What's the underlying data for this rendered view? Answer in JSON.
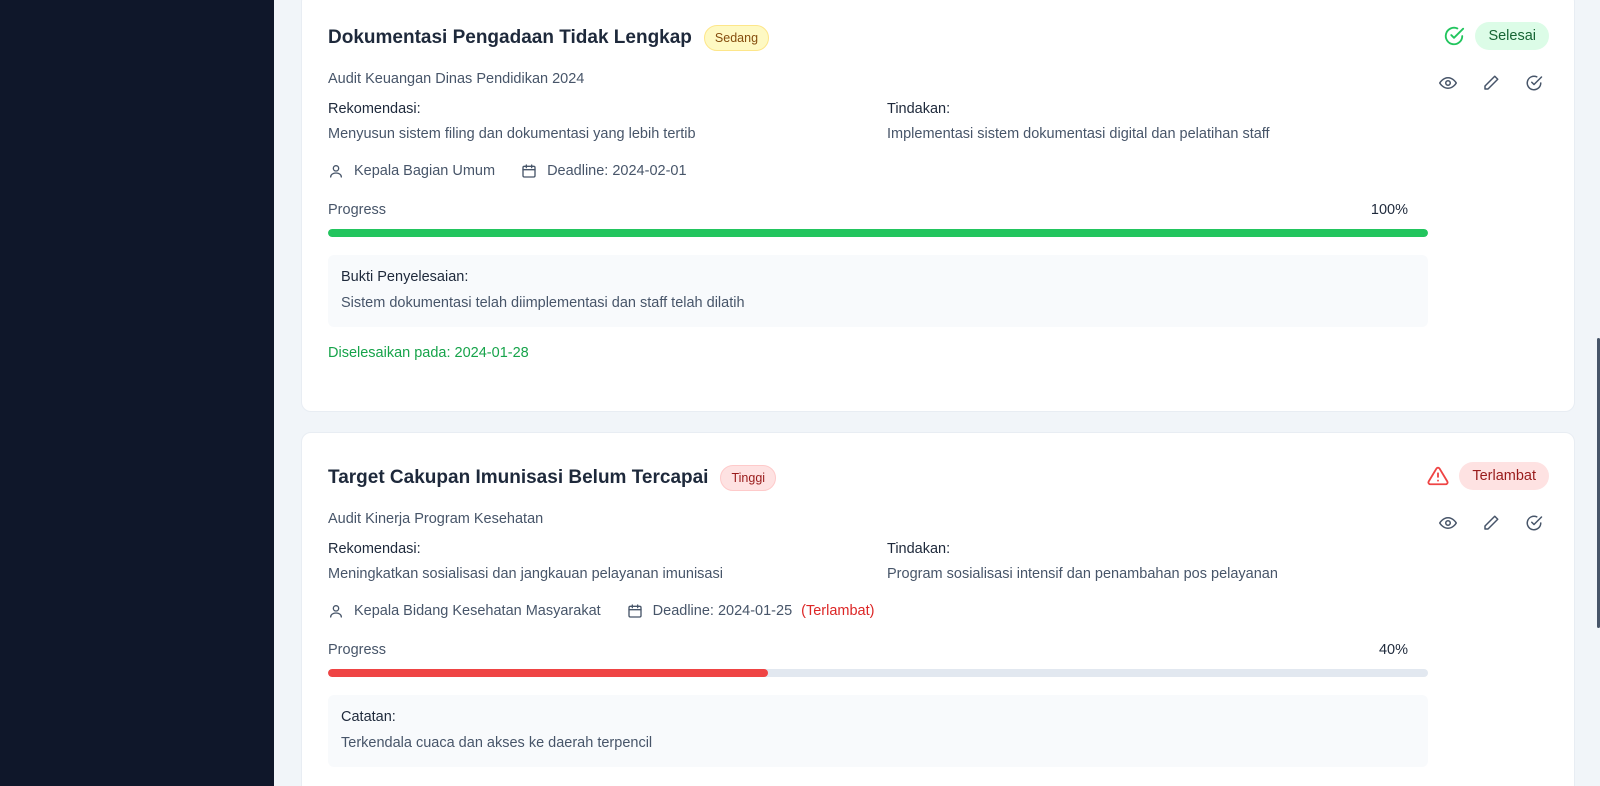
{
  "findings": [
    {
      "title": "Dokumentasi Pengadaan Tidak Lengkap",
      "priority": "Sedang",
      "audit": "Audit Keuangan Dinas Pendidikan 2024",
      "recommendation_label": "Rekomendasi:",
      "recommendation": "Menyusun sistem filing dan dokumentasi yang lebih tertib",
      "action_label": "Tindakan:",
      "action": "Implementasi sistem dokumentasi digital dan pelatihan staff",
      "pic": "Kepala Bagian Umum",
      "deadline": "Deadline: 2024-02-01",
      "progress_label": "Progress",
      "progress_text": "100%",
      "progress_fraction": 1.0,
      "note_title": "Bukti Penyelesaian:",
      "note_text": "Sistem dokumentasi telah diimplementasi dan staff telah dilatih",
      "completed_at": "Diselesaikan pada: 2024-01-28",
      "status": "Selesai",
      "status_icon": "check-circle-icon",
      "progress_color": "#22c55e"
    },
    {
      "title": "Target Cakupan Imunisasi Belum Tercapai",
      "priority": "Tinggi",
      "audit": "Audit Kinerja Program Kesehatan",
      "recommendation_label": "Rekomendasi:",
      "recommendation": "Meningkatkan sosialisasi dan jangkauan pelayanan imunisasi",
      "action_label": "Tindakan:",
      "action": "Program sosialisasi intensif dan penambahan pos pelayanan",
      "pic": "Kepala Bidang Kesehatan Masyarakat",
      "deadline": "Deadline: 2024-01-25",
      "overdue_note": "(Terlambat)",
      "progress_label": "Progress",
      "progress_text": "40%",
      "progress_fraction": 0.4,
      "note_title": "Catatan:",
      "note_text": "Terkendala cuaca dan akses ke daerah terpencil",
      "status": "Terlambat",
      "status_icon": "alert-triangle-icon",
      "progress_color": "#ef4444"
    }
  ],
  "actions": [
    "view-icon",
    "edit-icon",
    "complete-icon"
  ]
}
